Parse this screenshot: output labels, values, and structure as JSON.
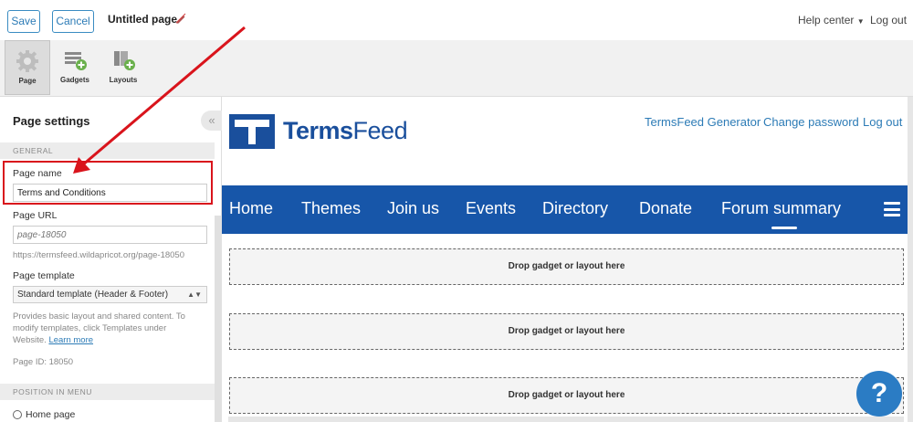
{
  "topbar": {
    "save_label": "Save",
    "cancel_label": "Cancel",
    "page_title": "Untitled page",
    "help_center": "Help center",
    "logout": "Log out"
  },
  "toolbar": {
    "tools": [
      {
        "label": "Page",
        "icon": "gear-icon",
        "active": true
      },
      {
        "label": "Gadgets",
        "icon": "gadgets-icon",
        "active": false
      },
      {
        "label": "Layouts",
        "icon": "layouts-icon",
        "active": false
      }
    ]
  },
  "left_panel": {
    "title": "Page settings",
    "general_header": "GENERAL",
    "page_name_label": "Page name",
    "page_name_value": "Terms and Conditions",
    "page_url_label": "Page URL",
    "page_url_placeholder": "page-18050",
    "page_url_full": "https://termsfeed.wildapricot.org/page-18050",
    "page_template_label": "Page template",
    "page_template_value": "Standard template (Header & Footer)",
    "template_help_1": "Provides basic layout and shared content. To",
    "template_help_2": "modify templates, click Templates under",
    "template_help_3": "Website.",
    "learn_more": "Learn more",
    "page_id": "Page ID: 18050",
    "position_header": "POSITION IN MENU",
    "home_page_label": "Home page"
  },
  "site": {
    "brand_terms": "Terms",
    "brand_feed": "Feed",
    "links": [
      "TermsFeed Generator",
      "Change password",
      "Log out"
    ],
    "nav": [
      "Home",
      "Themes",
      "Join us",
      "Events",
      "Directory",
      "Donate",
      "Forum summary"
    ],
    "drop_zone_label": "Drop gadget or layout here"
  },
  "help_bubble": "?",
  "colors": {
    "accent": "#2c7bb6",
    "nav_bg": "#1756a9",
    "brand": "#1a4f9c",
    "annotation": "#d9141c"
  }
}
